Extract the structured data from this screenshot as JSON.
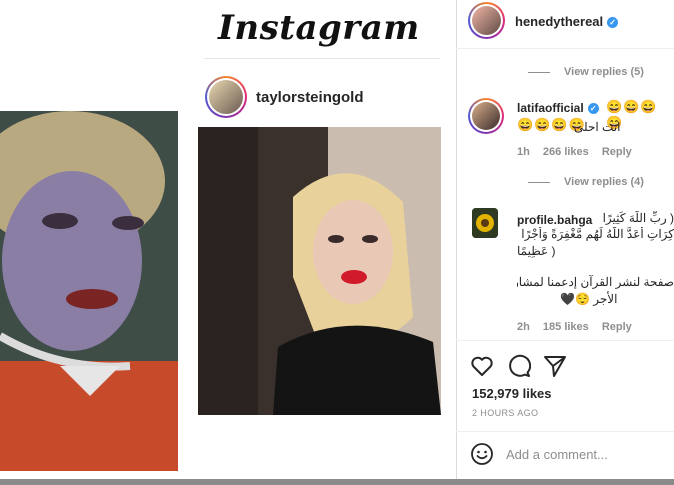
{
  "left_post": {
    "logo": "Instagram",
    "username": "taylorsteingold"
  },
  "panel": {
    "header": {
      "username": "henedythereal"
    },
    "comments": [
      {
        "replies_label": "View replies (5)"
      },
      {
        "username": "latifaofficial",
        "emojis_line1": "😄😄😄😄",
        "emojis_line2": "😄😄😄😄",
        "text": "انت احلى",
        "time": "1h",
        "likes": "266 likes",
        "reply": "Reply",
        "replies_label": "View replies (4)"
      },
      {
        "username": "profile.bahga",
        "text_line1": "( ربِّ اللَّهَ كَثِيرًا",
        "text_line2": "كِرَاتِ أَعَدَّ اللَّهُ لَهُم مَّغْفِرَةً وَأَجْرًا",
        "text_line3": "( عَظِيمًا",
        "text_line4": "صفحة لنشر القرآن إدعمنا لمشاركة",
        "text_line5": "الأجر 😌🖤",
        "time": "2h",
        "likes": "185 likes",
        "reply": "Reply"
      }
    ],
    "likes": "152,979 likes",
    "time": "2 HOURS AGO",
    "comment_placeholder": "Add a comment..."
  },
  "colors": {
    "verified": "#3897f0",
    "muted": "#8e8e8e",
    "text": "#262626"
  }
}
